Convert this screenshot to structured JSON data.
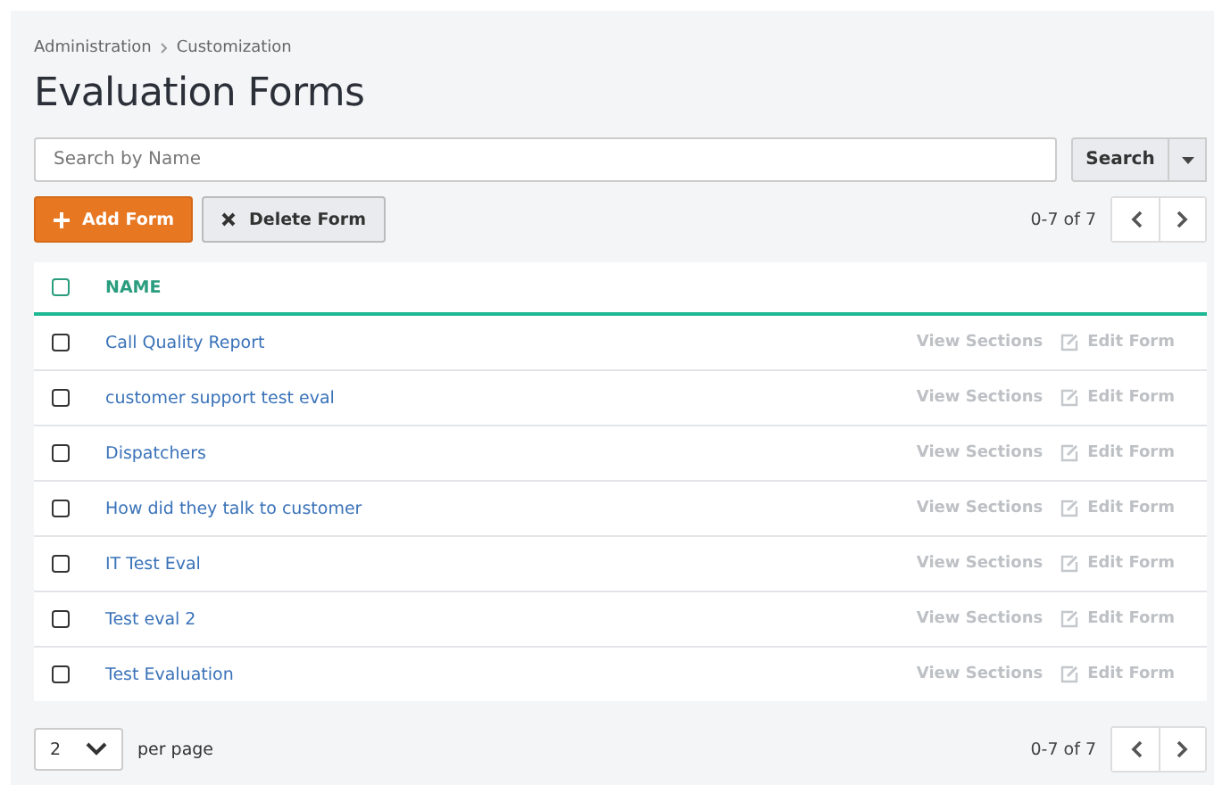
{
  "breadcrumb": [
    "Administration",
    "Customization"
  ],
  "title": "Evaluation Forms",
  "search": {
    "placeholder": "Search by Name",
    "button": "Search"
  },
  "toolbar": {
    "add": "Add Form",
    "delete": "Delete Form",
    "range": "0-7 of 7"
  },
  "table": {
    "header": {
      "checked": false,
      "name": "NAME"
    },
    "rows": [
      {
        "checked": false,
        "name": "Call Quality Report",
        "view": "View Sections",
        "edit": "Edit Form"
      },
      {
        "checked": false,
        "name": "customer support test eval",
        "view": "View Sections",
        "edit": "Edit Form"
      },
      {
        "checked": false,
        "name": "Dispatchers",
        "view": "View Sections",
        "edit": "Edit Form"
      },
      {
        "checked": false,
        "name": "How did they talk to customer",
        "view": "View Sections",
        "edit": "Edit Form"
      },
      {
        "checked": false,
        "name": "IT Test Eval",
        "view": "View Sections",
        "edit": "Edit Form"
      },
      {
        "checked": false,
        "name": "Test eval 2",
        "view": "View Sections",
        "edit": "Edit Form"
      },
      {
        "checked": false,
        "name": "Test Evaluation",
        "view": "View Sections",
        "edit": "Edit Form"
      }
    ]
  },
  "footer": {
    "page_size": "2",
    "per_page": "per page",
    "range": "0-7 of 7"
  }
}
